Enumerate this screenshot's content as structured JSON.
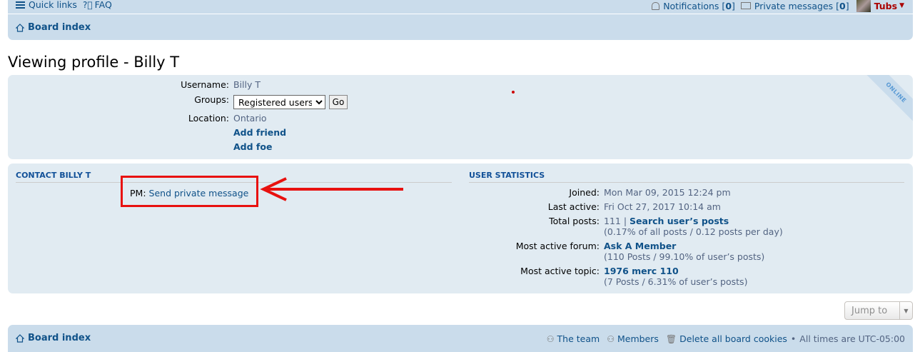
{
  "navbar": {
    "quick_links": "Quick links",
    "faq": "FAQ",
    "notifications_label": "Notifications",
    "notifications_count": "0",
    "pm_label": "Private messages",
    "pm_count": "0",
    "username": "Tubs",
    "board_index": "Board index"
  },
  "page": {
    "title": "Viewing profile - Billy T"
  },
  "profile": {
    "username_label": "Username:",
    "username": "Billy T",
    "groups_label": "Groups:",
    "groups_selected": "Registered users",
    "go_button": "Go",
    "location_label": "Location:",
    "location": "Ontario",
    "add_friend": "Add friend",
    "add_foe": "Add foe",
    "online_badge": "ONLINE"
  },
  "contact": {
    "heading": "CONTACT BILLY T",
    "pm_label": "PM:",
    "pm_link": "Send private message"
  },
  "stats": {
    "heading": "USER STATISTICS",
    "joined_label": "Joined:",
    "joined": "Mon Mar 09, 2015 12:24 pm",
    "last_active_label": "Last active:",
    "last_active": "Fri Oct 27, 2017 10:14 am",
    "total_posts_label": "Total posts:",
    "total_posts": "111",
    "search_posts": "Search user’s posts",
    "posts_detail": "(0.17% of all posts / 0.12 posts per day)",
    "active_forum_label": "Most active forum:",
    "active_forum": "Ask A Member",
    "active_forum_detail": "(110 Posts / 99.10% of user’s posts)",
    "active_topic_label": "Most active topic:",
    "active_topic": "1976 merc 110",
    "active_topic_detail": "(7 Posts / 6.31% of user’s posts)"
  },
  "jump_to": "Jump to",
  "footer": {
    "board_index": "Board index",
    "the_team": "The team",
    "members": "Members",
    "delete_cookies": "Delete all board cookies",
    "timezone": "All times are UTC-05:00"
  },
  "colors": {
    "navbar_bg": "#cadceb",
    "panel_bg": "#e1ebf2",
    "link": "#105289",
    "highlight": "#e8110f",
    "username_color": "#aa0000"
  }
}
